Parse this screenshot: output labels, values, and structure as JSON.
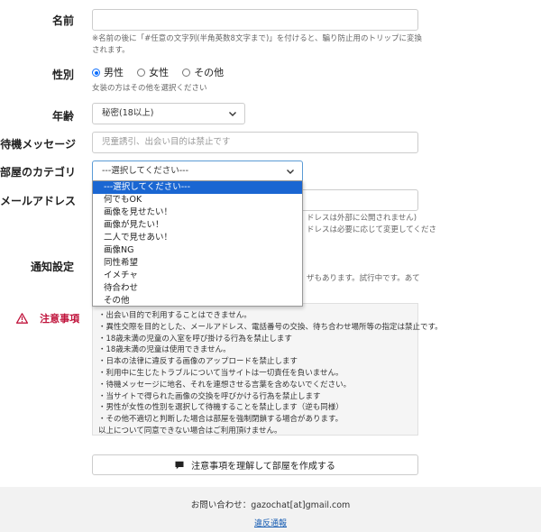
{
  "form": {
    "name": {
      "label": "名前",
      "note_line1": "※名前の後に「#任意の文字列(半角英数8文字まで)」を付けると、騙り防止用のトリップに変換",
      "note_line2": "されます。"
    },
    "gender": {
      "label": "性別",
      "options": [
        "男性",
        "女性",
        "その他"
      ],
      "selected": "男性",
      "note": "女装の方はその他を選択ください"
    },
    "age": {
      "label": "年齢",
      "value": "秘密(18以上)"
    },
    "message": {
      "label": "待機メッセージ",
      "placeholder": "児童誘引、出会い目的は禁止です"
    },
    "category": {
      "label": "部屋のカテゴリ",
      "value": "---選択してください---",
      "options": [
        "---選択してください---",
        "何でもOK",
        "画像を見せたい！",
        "画像が見たい！",
        "二人で見せあい！",
        "画像NG",
        "同性希望",
        "イメチャ",
        "待合わせ",
        "その他"
      ]
    },
    "email": {
      "label": "メールアドレス",
      "note_line1_tail": "ドレスは外部に公開されません)",
      "note_line2_tail": "ドレスは必要に応じて変更してくださ"
    },
    "notify": {
      "label": "通知設定",
      "note_tail": "ザもあります。試行中です。あて"
    }
  },
  "notice": {
    "title": "注意事項",
    "lines": [
      "・出会い目的で利用することはできません。",
      "・異性交際を目的とした、メールアドレス、電話番号の交換、待ち合わせ場所等の指定は禁止です。",
      "・18歳未満の児童の入室を呼び掛ける行為を禁止します",
      "・18歳未満の児童は使用できません。",
      "・日本の法律に違反する画像のアップロードを禁止します",
      "・利用中に生じたトラブルについて当サイトは一切責任を負いません。",
      "・待機メッセージに地名、それを連想させる言葉を含めないでください。",
      "・当サイトで得られた画像の交換を呼びかける行為を禁止します",
      "・男性が女性の性別を選択して待機することを禁止します（逆も同様）",
      "・その他不適切と判断した場合は部屋を強制閉鎖する場合があります。",
      "以上について同意できない場合はご利用頂けません。"
    ]
  },
  "submit": {
    "label": "注意事項を理解して部屋を作成する"
  },
  "footer": {
    "contact": "お問い合わせ：gazochat[at]gmail.com",
    "report_link": "違反通報"
  },
  "colors": {
    "accent": "#0d6efd",
    "dropdown_selected": "#1a66d2",
    "warning": "#c0143c",
    "link": "#1a5fb4"
  }
}
